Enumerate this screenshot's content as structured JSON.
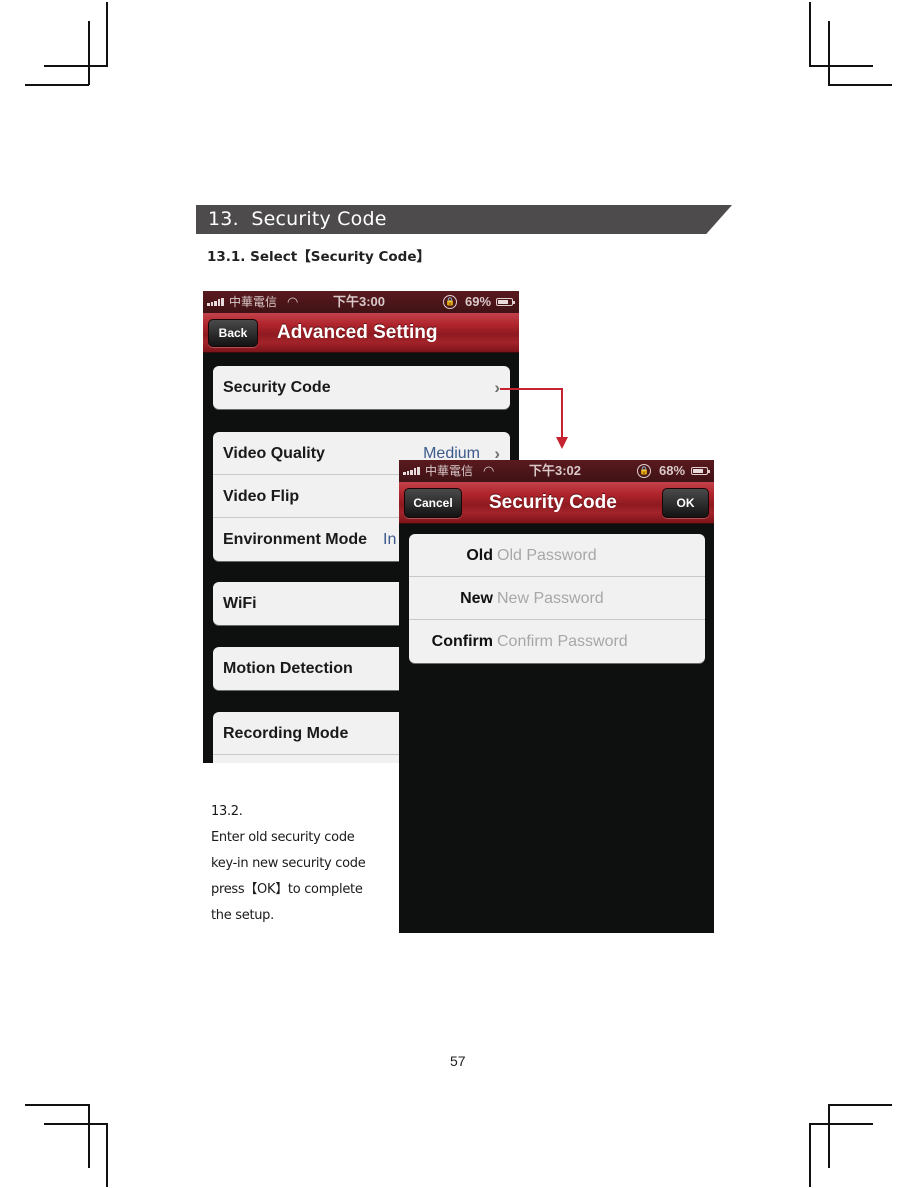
{
  "section": {
    "number": "13.",
    "title": "Security Code"
  },
  "step1": {
    "label": "13.1.  Select【Security Code】"
  },
  "step2": {
    "number": "13.2.",
    "lines": [
      "Enter old security code",
      "key-in new security code",
      "press【OK】to complete",
      "the setup."
    ]
  },
  "page_number": "57",
  "colors": {
    "nav_red": "#b0242c",
    "arrow_red": "#c4232f",
    "section_bar": "#4d4b4c",
    "value_blue": "#3c5a8c"
  },
  "screen1": {
    "status": {
      "carrier": "中華電信",
      "wifi_icon": "wifi-icon",
      "time": "下午3:00",
      "battery": "69%"
    },
    "nav": {
      "back": "Back",
      "title": "Advanced Setting"
    },
    "groups": [
      [
        {
          "label": "Security Code",
          "value": "",
          "chevron": true
        }
      ],
      [
        {
          "label": "Video Quality",
          "value": "Medium",
          "chevron": true
        },
        {
          "label": "Video Flip",
          "value": "",
          "chevron": false
        },
        {
          "label": "Environment Mode",
          "value": "In",
          "chevron": false
        }
      ],
      [
        {
          "label": "WiFi",
          "value": "",
          "chevron": false
        }
      ],
      [
        {
          "label": "Motion Detection",
          "value": "",
          "chevron": false
        }
      ],
      [
        {
          "label": "Recording Mode",
          "value": "",
          "chevron": false
        }
      ]
    ]
  },
  "screen2": {
    "status": {
      "carrier": "中華電信",
      "wifi_icon": "wifi-icon",
      "time": "下午3:02",
      "battery": "68%"
    },
    "nav": {
      "cancel": "Cancel",
      "title": "Security Code",
      "ok": "OK"
    },
    "fields": [
      {
        "label": "Old",
        "placeholder": "Old Password",
        "value": ""
      },
      {
        "label": "New",
        "placeholder": "New Password",
        "value": ""
      },
      {
        "label": "Confirm",
        "placeholder": "Confirm Password",
        "value": ""
      }
    ]
  }
}
